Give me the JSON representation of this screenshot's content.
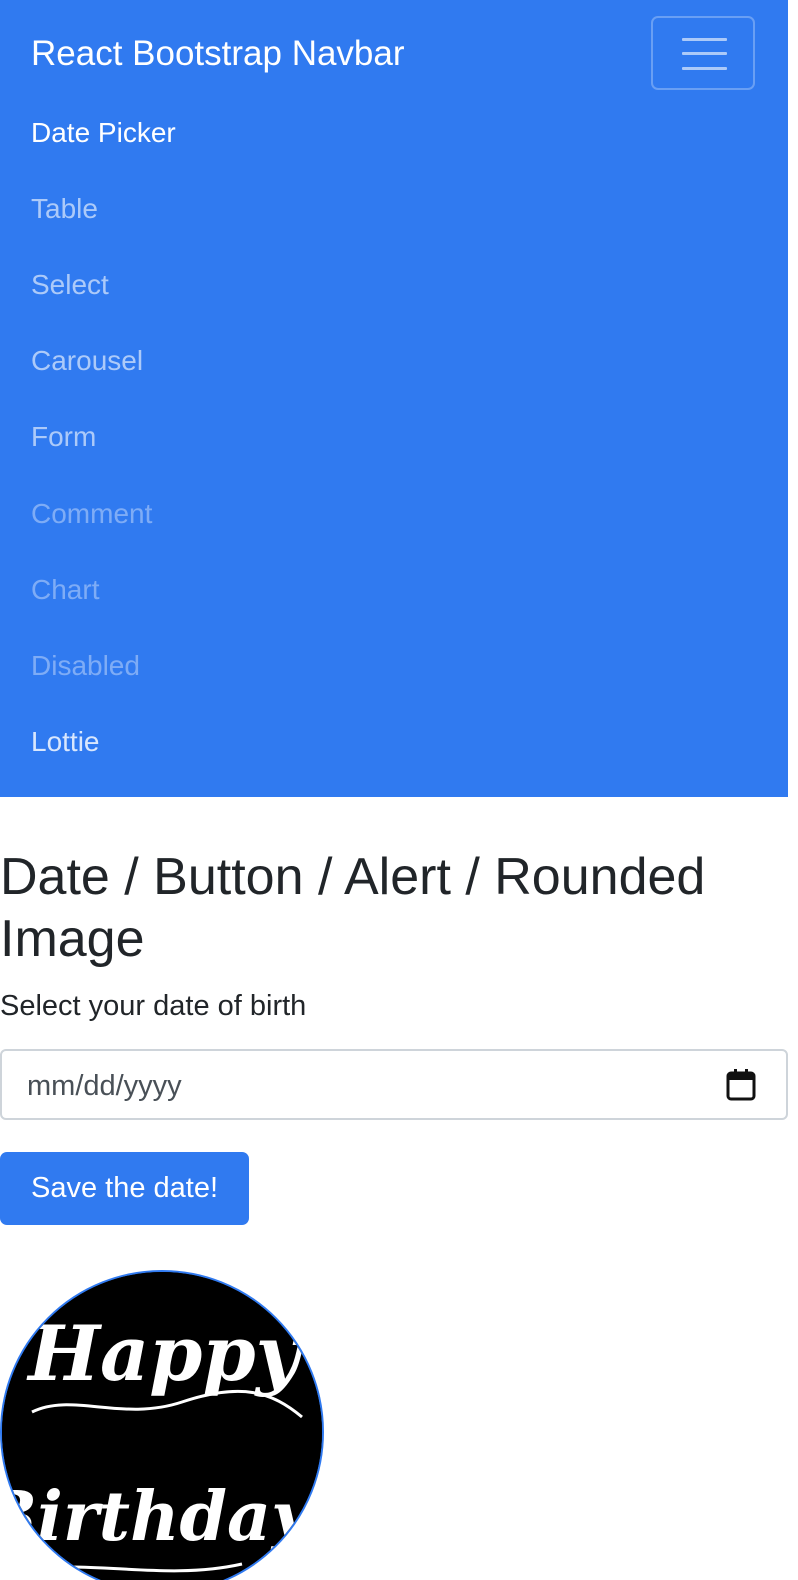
{
  "navbar": {
    "brand": "React Bootstrap Navbar",
    "toggler_icon": "hamburger-menu-icon",
    "links": [
      {
        "label": "Date Picker",
        "state": "active"
      },
      {
        "label": "Table",
        "state": "normal"
      },
      {
        "label": "Select",
        "state": "normal"
      },
      {
        "label": "Carousel",
        "state": "normal"
      },
      {
        "label": "Form",
        "state": "normal"
      },
      {
        "label": "Comment",
        "state": "disabled"
      },
      {
        "label": "Chart",
        "state": "disabled"
      },
      {
        "label": "Disabled",
        "state": "disabled"
      },
      {
        "label": "Lottie",
        "state": "normal"
      }
    ]
  },
  "main": {
    "title": "Date / Button / Alert / Rounded Image",
    "date_label": "Select your date of birth",
    "date_placeholder": "mm/dd/yyyy",
    "calendar_icon": "calendar-icon",
    "save_button": "Save the date!",
    "image": {
      "line1": "Happy",
      "line2": "Birthday!"
    }
  },
  "colors": {
    "primary": "#307af0",
    "text": "#212529",
    "input_border": "#ced4da",
    "image_background": "#000000"
  }
}
